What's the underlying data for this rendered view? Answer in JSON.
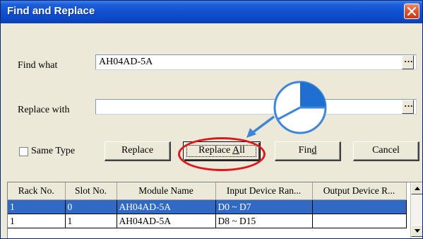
{
  "dialog": {
    "title": "Find and Replace"
  },
  "find_what": {
    "label": "Find what",
    "value": "AH04AD-5A"
  },
  "replace_with": {
    "label": "Replace with",
    "value": ""
  },
  "options": {
    "same_type_label": "Same Type",
    "same_type_checked": false
  },
  "buttons": {
    "replace": "Replace",
    "replace_all_pre": "Replace ",
    "replace_all_accel": "A",
    "replace_all_post": "ll",
    "find_pre": "Fin",
    "find_accel": "d",
    "cancel": "Cancel"
  },
  "results": {
    "columns": [
      "Rack No.",
      "Slot No.",
      "Module Name",
      "Input Device Ran...",
      "Output Device R..."
    ],
    "rows": [
      [
        "1",
        "0",
        "AH04AD-5A",
        "D0 ~ D7",
        ""
      ],
      [
        "1",
        "1",
        "AH04AD-5A",
        "D8 ~ D15",
        ""
      ]
    ],
    "selected_row": 0
  },
  "annotation": {
    "highlight_color": "#e0161c",
    "pointer_color": "#3f86d8",
    "icon": "mouse-click-icon"
  },
  "colors": {
    "titlebar": "#0f4fd0",
    "selection": "#316ac5",
    "dialog_face": "#ece9d8"
  }
}
